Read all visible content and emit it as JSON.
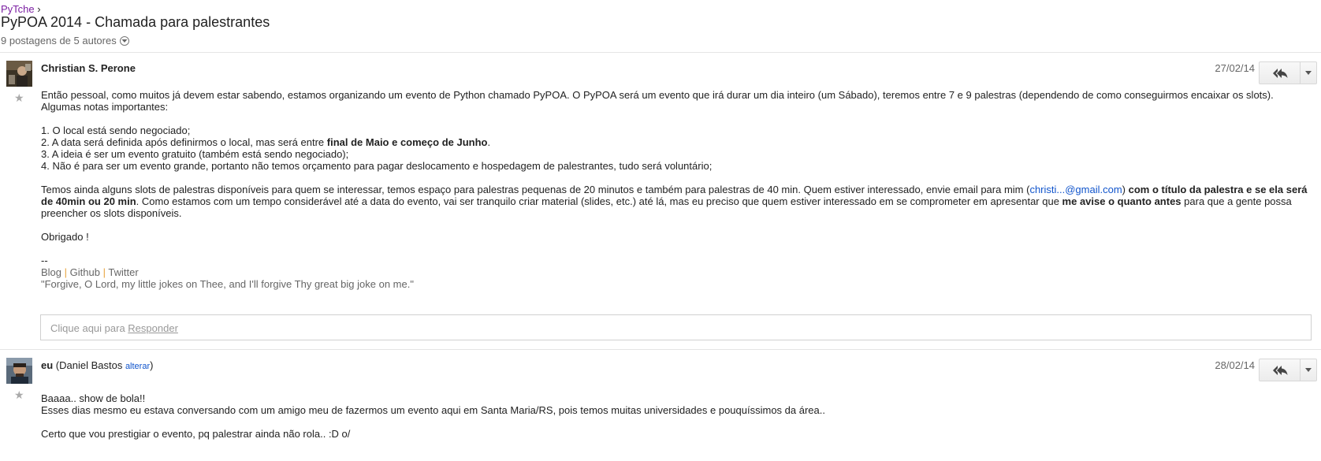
{
  "breadcrumb": {
    "group": "PyTche",
    "separator": "›"
  },
  "thread": {
    "title": "PyPOA 2014 - Chamada para palestrantes",
    "meta": "9 postagens de 5 autores",
    "meta_toggle_icon": "chevron-down-circle-icon"
  },
  "posts": [
    {
      "author": "Christian S. Perone",
      "date": "27/02/14",
      "star_icon": "star-icon",
      "reply_icon": "reply-all-icon",
      "more_icon": "caret-down-icon",
      "paragraph1": {
        "line1": "Então pessoal, como muitos já devem estar sabendo, estamos organizando um evento de Python chamado PyPOA. O PyPOA será um evento que irá durar um dia inteiro (um Sábado), teremos entre 7 e 9 palestras (dependendo de como conseguirmos encaixar os slots).",
        "line2": "Algumas notas importantes:"
      },
      "notes": {
        "item1": "1. O local está sendo negociado;",
        "item2_pre": "2. A data será definida após definirmos o local, mas será entre ",
        "item2_bold": "final de Maio e começo de Junho",
        "item2_post": ".",
        "item3": "3. A ideia é ser um evento gratuito (também está sendo negociado);",
        "item4": "4. Não é para ser um evento grande, portanto não temos orçamento para pagar deslocamento e hospedagem de palestrantes, tudo será voluntário;"
      },
      "paragraph2": {
        "part1": "Temos ainda alguns slots de palestras disponíveis para quem se interessar, temos espaço para palestras pequenas de 20 minutos e também para palestras de 40 min. Quem estiver interessado, envie email para mim (",
        "email": "christi...@gmail.com",
        "part2": ") ",
        "bold1": "com o título da palestra e se ela será de 40min ou 20 min",
        "part3": ". Como estamos com um tempo considerável até a data do evento, vai ser tranquilo criar material (slides, etc.) até lá, mas eu preciso que quem estiver interessado em se comprometer em apresentar que ",
        "bold2": "me avise o quanto antes",
        "part4": " para que a gente possa preencher os slots disponíveis."
      },
      "thanks": "Obrigado !",
      "signature": {
        "dash": "--",
        "blog": "Blog",
        "github": "Github",
        "twitter": "Twitter",
        "sep": "|",
        "quote": "\"Forgive, O Lord, my little jokes on Thee, and I'll forgive Thy great big joke on me.\""
      }
    },
    {
      "author_bold": "eu",
      "author_rest_open": " (Daniel Bastos ",
      "change_link": "alterar",
      "author_rest_close": ")",
      "date": "28/02/14",
      "star_icon": "star-icon",
      "reply_icon": "reply-all-icon",
      "more_icon": "caret-down-icon",
      "line1": "Baaaa.. show de bola!!",
      "line2": "Esses dias mesmo eu estava conversando com um amigo meu de fazermos um evento aqui em Santa Maria/RS, pois temos muitas universidades e pouquíssimos da área..",
      "line3": "Certo que vou prestigiar o evento, pq palestrar ainda não rola.. :D o/"
    }
  ],
  "reply_box": {
    "prefix": "Clique aqui para ",
    "link": "Responder"
  }
}
